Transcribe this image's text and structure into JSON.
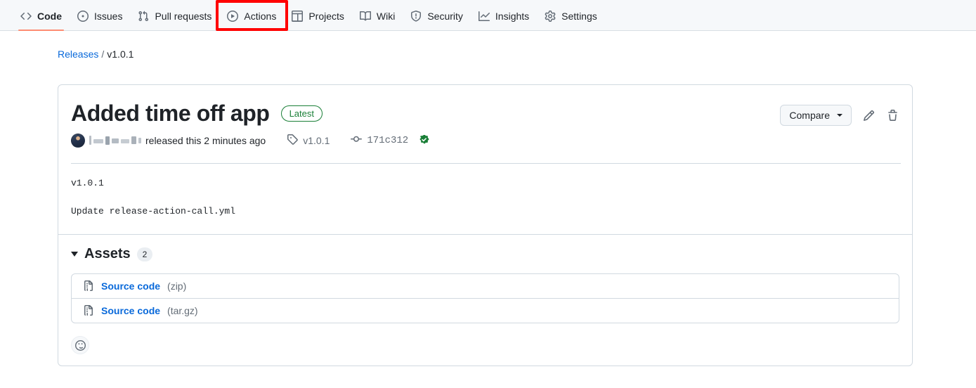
{
  "nav": {
    "items": [
      {
        "label": "Code",
        "icon": "code-icon",
        "active": true
      },
      {
        "label": "Issues",
        "icon": "issue-opened-icon",
        "active": false
      },
      {
        "label": "Pull requests",
        "icon": "git-pull-request-icon",
        "active": false
      },
      {
        "label": "Actions",
        "icon": "play-icon",
        "active": false
      },
      {
        "label": "Projects",
        "icon": "table-icon",
        "active": false
      },
      {
        "label": "Wiki",
        "icon": "book-icon",
        "active": false
      },
      {
        "label": "Security",
        "icon": "shield-icon",
        "active": false
      },
      {
        "label": "Insights",
        "icon": "graph-icon",
        "active": false
      },
      {
        "label": "Settings",
        "icon": "gear-icon",
        "active": false
      }
    ],
    "highlight_target": "Actions",
    "highlight_color": "#ff0000",
    "active_underline_color": "#fd8c73"
  },
  "breadcrumb": {
    "root_label": "Releases",
    "separator": "/",
    "current_label": "v1.0.1"
  },
  "release": {
    "title": "Added time off app",
    "latest_badge": "Latest",
    "latest_badge_color": "#1a7f37",
    "compare_button": "Compare",
    "edit_icon": "pencil-icon",
    "delete_icon": "trash-icon",
    "meta": {
      "author_redacted": true,
      "released_text": "released this 2 minutes ago",
      "tag_label": "v1.0.1",
      "tag_icon": "tag-icon",
      "commit_hash": "171c312",
      "commit_icon": "commit-icon",
      "verified_icon": "verified-check-icon",
      "verified_color": "#1a7f37"
    },
    "body": [
      "v1.0.1",
      "Update release-action-call.yml"
    ]
  },
  "assets": {
    "title": "Assets",
    "count": "2",
    "expanded": true,
    "rows": [
      {
        "icon": "file-zip-icon",
        "name": "Source code",
        "ext": "(zip)"
      },
      {
        "icon": "file-zip-icon",
        "name": "Source code",
        "ext": "(tar.gz)"
      }
    ]
  },
  "reaction": {
    "icon": "smiley-icon",
    "label": ""
  }
}
